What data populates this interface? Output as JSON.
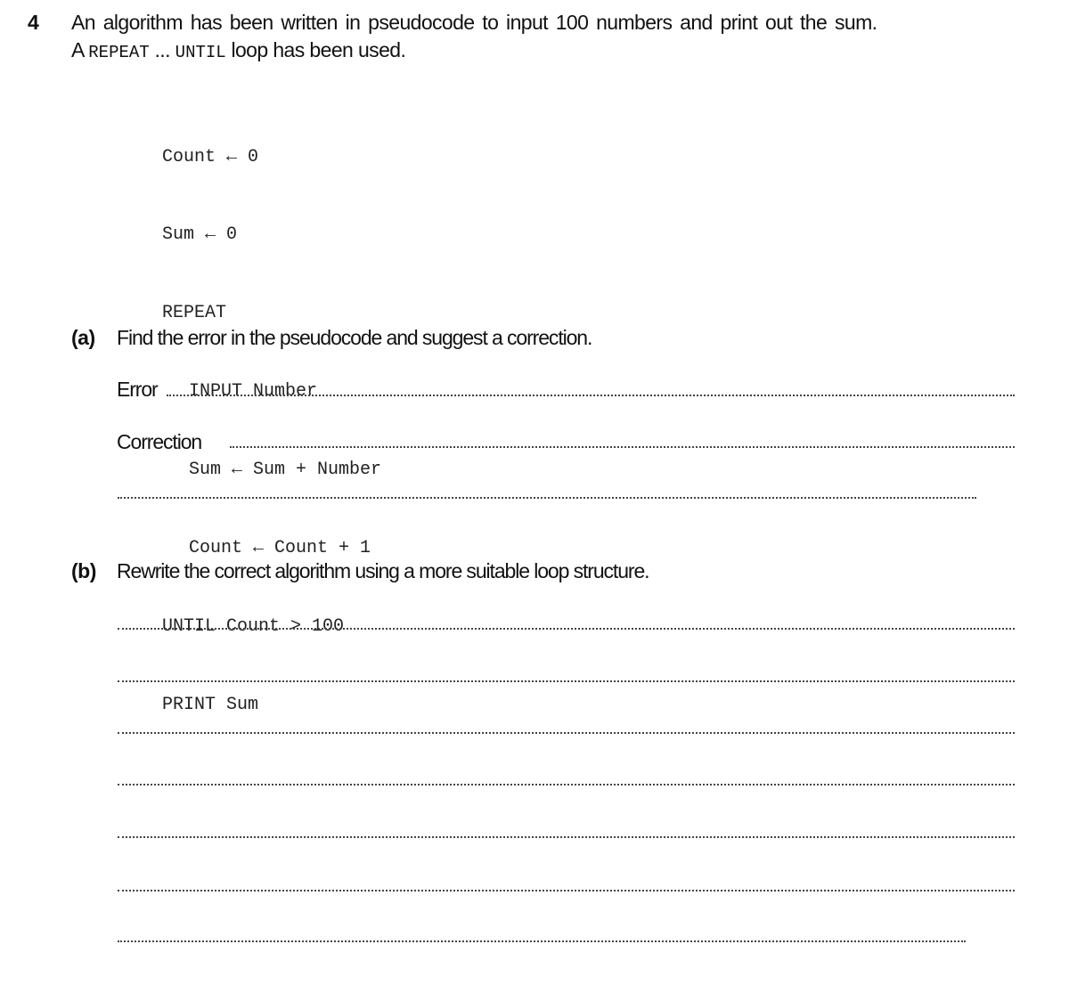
{
  "question": {
    "number": "4",
    "intro_line1": "An algorithm has been written in pseudocode to input 100 numbers and print out the sum.",
    "intro_line2": {
      "prefix": "A",
      "keyword1": "REPEAT",
      "ellipsis": "...",
      "keyword2": "UNTIL",
      "suffix": "loop has been used."
    }
  },
  "pseudocode": [
    {
      "text": "Count ← 0",
      "indent": false
    },
    {
      "text": "Sum ← 0",
      "indent": false
    },
    {
      "text": "REPEAT",
      "indent": false
    },
    {
      "text": "INPUT Number",
      "indent": true
    },
    {
      "text": "Sum ← Sum + Number",
      "indent": true
    },
    {
      "text": "Count ← Count + 1",
      "indent": true
    },
    {
      "text": "UNTIL Count > 100",
      "indent": false
    },
    {
      "text": "PRINT Sum",
      "indent": false
    }
  ],
  "part_a": {
    "label": "(a)",
    "text": "Find the error in the pseudocode and suggest a correction.",
    "error_label": "Error",
    "correction_label": "Correction"
  },
  "part_b": {
    "label": "(b)",
    "text": "Rewrite the correct algorithm using a more suitable loop structure."
  }
}
